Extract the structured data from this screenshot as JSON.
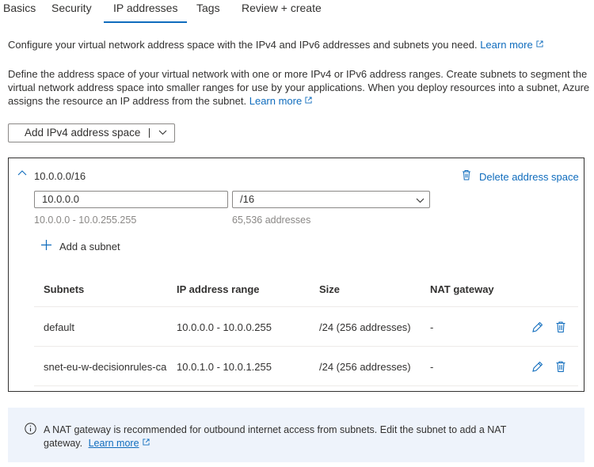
{
  "tabs": [
    {
      "label": "Basics",
      "active": false
    },
    {
      "label": "Security",
      "active": false
    },
    {
      "label": "IP addresses",
      "active": true
    },
    {
      "label": "Tags",
      "active": false
    },
    {
      "label": "Review + create",
      "active": false
    }
  ],
  "intro": {
    "line1": "Configure your virtual network address space with the IPv4 and IPv6 addresses and subnets you need.",
    "line1_link": "Learn more",
    "line2a": "Define the address space of your virtual network with one or more IPv4 or IPv6 address ranges. Create subnets to segment the",
    "line2b": "virtual network address space into smaller ranges for use by your applications. When you deploy resources into a subnet, Azure",
    "line2c": "assigns the resource an IP address from the subnet.",
    "line2_link": "Learn more"
  },
  "add_space_button": "Add IPv4 address space",
  "address_space": {
    "title": "10.0.0.0/16",
    "delete_label": "Delete address space",
    "address_value": "10.0.0.0",
    "cidr_value": "/16",
    "range_hint": "10.0.0.0 - 10.0.255.255",
    "count_hint": "65,536 addresses",
    "add_subnet_label": "Add a subnet"
  },
  "subnets_table": {
    "headers": [
      "Subnets",
      "IP address range",
      "Size",
      "NAT gateway"
    ],
    "rows": [
      {
        "name": "default",
        "range": "10.0.0.0 - 10.0.0.255",
        "size": "/24 (256 addresses)",
        "nat": "-"
      },
      {
        "name": "snet-eu-w-decisionrules-ca",
        "range": "10.0.1.0 - 10.0.1.255",
        "size": "/24 (256 addresses)",
        "nat": "-"
      }
    ]
  },
  "info_banner": {
    "line1": "A NAT gateway is recommended for outbound internet access from subnets. Edit the subnet to add a NAT",
    "line2": "gateway.",
    "link": "Learn more"
  },
  "icons": {
    "info": "info-icon",
    "external": "external-link-icon",
    "chevron": "chevron-down-icon",
    "chevron_up": "chevron-up-icon",
    "trash": "trash-icon",
    "edit": "pencil-icon",
    "add": "plus-icon"
  },
  "colors": {
    "accent": "#0f6cbd",
    "banner_bg": "#eef3fb",
    "border": "#323130"
  }
}
